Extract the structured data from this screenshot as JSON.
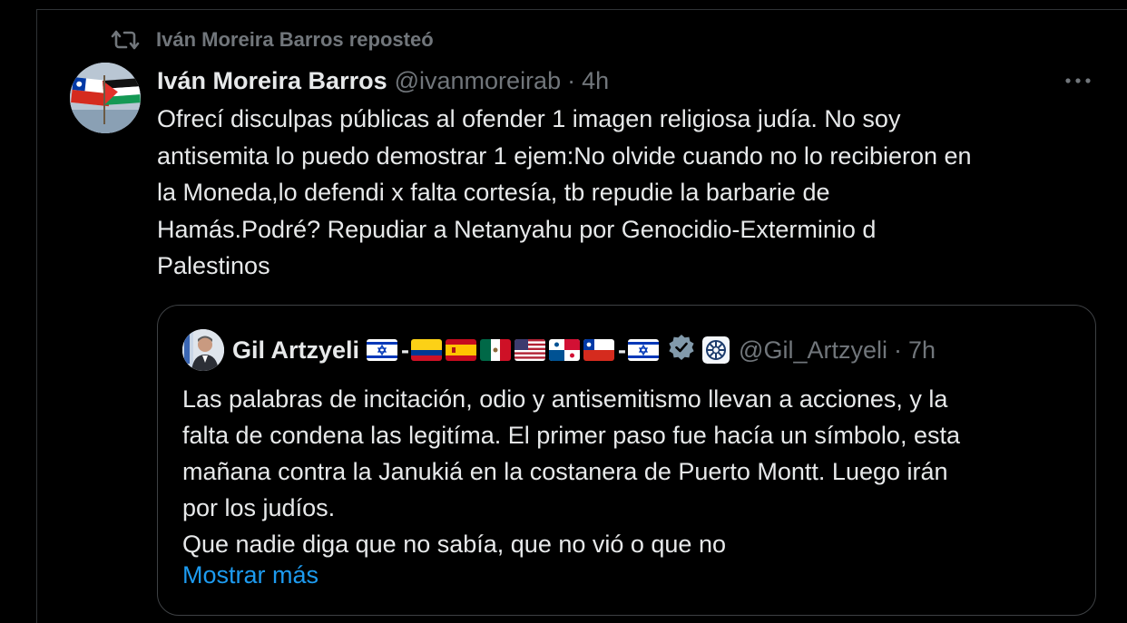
{
  "colors": {
    "background": "#000000",
    "text_primary": "#e7e9ea",
    "text_secondary": "#71767b",
    "link": "#1d9bf0",
    "border": "#2f3336",
    "verified_badge": "#829aab"
  },
  "repost": {
    "icon": "repost-icon",
    "label": "Iván Moreira Barros reposteó"
  },
  "tweet": {
    "author_name": "Iván Moreira Barros",
    "handle": "@ivanmoreirab",
    "separator": "·",
    "time": "4h",
    "more_icon": "more-options-icon",
    "text_lines": [
      "Ofrecí disculpas públicas al ofender 1 imagen religiosa judía. No soy",
      "antisemita lo puedo demostrar 1 ejem:No olvide cuando no lo recibieron en",
      "la Moneda,lo defendi x falta cortesía, tb repudie la barbarie de",
      "Hamás.Podré? Repudiar a Netanyahu por Genocidio-Exterminio d",
      "Palestinos"
    ]
  },
  "quote": {
    "author_name": "Gil Artzyeli",
    "name_flags": [
      "israel-flag",
      "colombia-flag",
      "spain-flag",
      "mexico-flag",
      "usa-flag",
      "panama-flag",
      "chile-flag",
      "israel-flag"
    ],
    "dash": "-",
    "verified_icon": "verified-badge-icon",
    "affiliation_icon": "affiliation-badge-icon",
    "handle": "@Gil_Artzyeli",
    "separator": "·",
    "time": "7h",
    "text_lines": [
      "Las palabras de incitación, odio y antisemitismo llevan a acciones, y la",
      "falta de condena las legitíma. El primer paso fue hacía un símbolo, esta",
      "mañana contra la Janukiá en la costanera de Puerto Montt. Luego irán",
      "por los judíos.",
      "Que nadie diga que no sabía, que no vió o que no"
    ],
    "show_more": "Mostrar más"
  }
}
